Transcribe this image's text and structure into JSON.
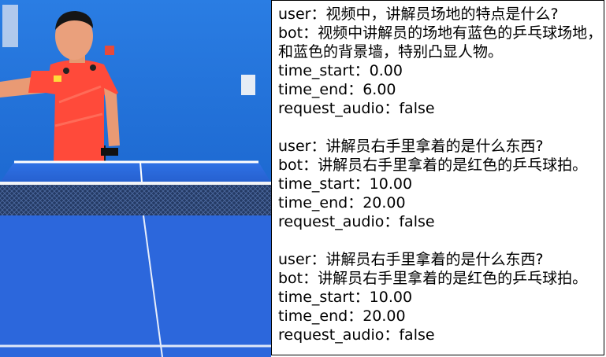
{
  "transcript": {
    "turns": [
      {
        "user": "user：视频中，讲解员场地的特点是什么?",
        "bot": "bot：视频中讲解员的场地有蓝色的乒乓球场地，和蓝色的背景墙，特别凸显人物。",
        "time_start": "time_start：0.00",
        "time_end": "time_end：6.00",
        "request_audio": "request_audio：false"
      },
      {
        "user": "user：讲解员右手里拿着的是什么东西?",
        "bot": "bot：讲解员右手里拿着的是红色的乒乓球拍。",
        "time_start": "time_start：10.00",
        "time_end": "time_end：20.00",
        "request_audio": "request_audio：false"
      },
      {
        "user": "user：讲解员右手里拿着的是什么东西?",
        "bot": "bot：讲解员右手里拿着的是红色的乒乓球拍。",
        "time_start": "time_start：10.00",
        "time_end": "time_end：20.00",
        "request_audio": "request_audio：false"
      }
    ]
  },
  "colors": {
    "wall": "#1f6fd8",
    "table": "#2f6fe0",
    "shirt": "#ff4a3a",
    "net": "#1d2b4a"
  }
}
